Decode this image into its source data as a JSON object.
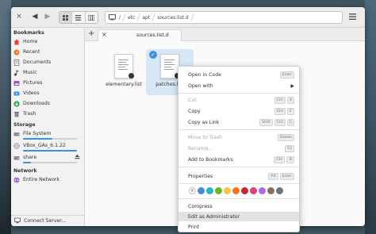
{
  "window": {
    "close_glyph": "×",
    "back_glyph": "◀",
    "forward_glyph": "▶",
    "view_icons": [
      "grid-view-icon",
      "list-view-icon",
      "column-view-icon"
    ],
    "breadcrumb": [
      "/",
      "etc",
      "apt",
      "sources.list.d"
    ]
  },
  "sidebar": {
    "bookmarks_heading": "Bookmarks",
    "bookmarks": [
      {
        "label": "Home",
        "icon": "home-icon",
        "color": "#e8453c"
      },
      {
        "label": "Recent",
        "icon": "recent-icon",
        "color": "#e07b39"
      },
      {
        "label": "Documents",
        "icon": "documents-icon",
        "color": "#6b6b6b"
      },
      {
        "label": "Music",
        "icon": "music-icon",
        "color": "#555555"
      },
      {
        "label": "Pictures",
        "icon": "pictures-icon",
        "color": "#9c4fc9"
      },
      {
        "label": "Videos",
        "icon": "videos-icon",
        "color": "#3d8fe0"
      },
      {
        "label": "Downloads",
        "icon": "downloads-icon",
        "color": "#37a347"
      },
      {
        "label": "Trash",
        "icon": "trash-icon",
        "color": "#6b6b6b"
      }
    ],
    "storage_heading": "Storage",
    "storage": [
      {
        "label": "File System",
        "icon": "drive-icon",
        "usage": 0.55
      },
      {
        "label": "VBox_GAs_6.1.22",
        "icon": "disc-icon",
        "usage": 1.0
      },
      {
        "label": "share",
        "icon": "drive-icon",
        "usage": 0.15,
        "eject": true
      }
    ],
    "network_heading": "Network",
    "network": [
      {
        "label": "Entire Network",
        "icon": "network-icon",
        "color": "#9c4fc9"
      }
    ],
    "connect_label": "Connect Server..."
  },
  "tabs": {
    "add_glyph": "+",
    "close_glyph": "×",
    "active_tab": "sources.list.d"
  },
  "files": [
    {
      "name": "elementary.list",
      "selected": false
    },
    {
      "name": "patches.list",
      "selected": true
    }
  ],
  "context_menu": {
    "items": [
      {
        "label": "Open in Code",
        "keys": [
          "Enter"
        ],
        "disabled": false
      },
      {
        "label": "Open with",
        "submenu": true,
        "disabled": false
      },
      {
        "label": "Cut",
        "keys": [
          "Ctrl",
          "X"
        ],
        "disabled": true
      },
      {
        "label": "Copy",
        "keys": [
          "Ctrl",
          "C"
        ],
        "disabled": false
      },
      {
        "label": "Copy as Link",
        "keys": [
          "Shift",
          "Ctrl",
          "C"
        ],
        "disabled": false
      },
      {
        "label": "Move to Trash",
        "keys": [
          "Delete"
        ],
        "disabled": true
      },
      {
        "label": "Rename...",
        "keys": [
          "F2"
        ],
        "disabled": true
      },
      {
        "label": "Add to Bookmarks",
        "keys": [
          "Ctrl",
          "D"
        ],
        "disabled": false
      },
      {
        "label": "Properties",
        "keys": [
          "Alt",
          "Enter"
        ],
        "disabled": false
      },
      {
        "label": "Compress",
        "disabled": false
      },
      {
        "label": "Edit as Administrator",
        "disabled": false,
        "highlighted": true
      },
      {
        "label": "Print",
        "disabled": false
      }
    ],
    "color_tags": [
      "#3d8fe0",
      "#2fb0c9",
      "#68b723",
      "#f9c440",
      "#f37329",
      "#c6262e",
      "#de3e80",
      "#a56de2",
      "#8a715e",
      "#667885"
    ]
  }
}
